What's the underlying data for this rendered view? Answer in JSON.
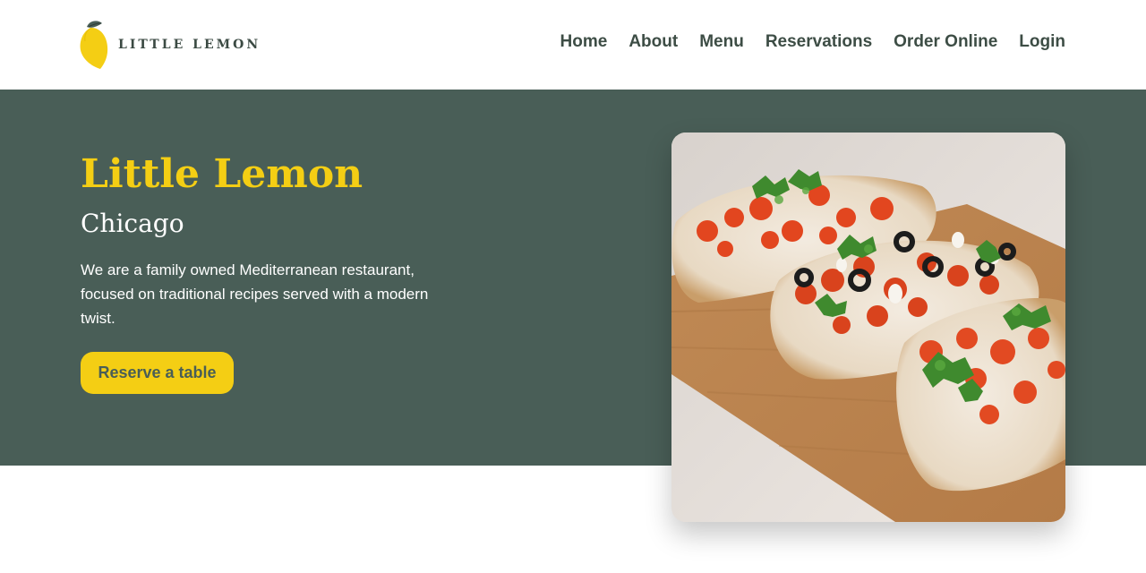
{
  "brand": {
    "name": "LITTLE LEMON",
    "logo_icon": "lemon-icon"
  },
  "nav": {
    "items": [
      {
        "label": "Home"
      },
      {
        "label": "About"
      },
      {
        "label": "Menu"
      },
      {
        "label": "Reservations"
      },
      {
        "label": "Order Online"
      },
      {
        "label": "Login"
      }
    ]
  },
  "hero": {
    "title": "Little Lemon",
    "subtitle": "Chicago",
    "description": "We are a family owned Mediterranean restaurant, focused on traditional recipes served with a modern twist.",
    "cta_label": "Reserve a table",
    "image_subject": "bruschetta"
  },
  "colors": {
    "primary_green": "#495e57",
    "primary_yellow": "#f4ce14",
    "white": "#ffffff",
    "nav_text": "#3d4d45"
  }
}
